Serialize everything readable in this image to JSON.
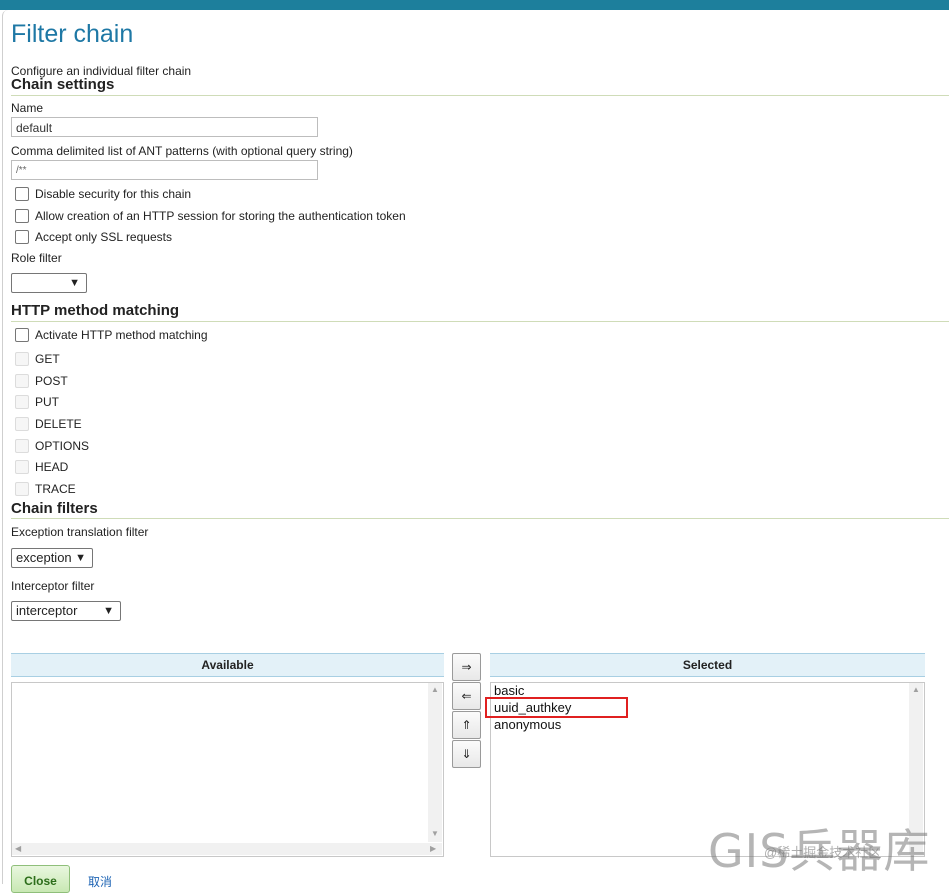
{
  "page": {
    "title": "Filter chain",
    "subtitle": "Configure an individual filter chain"
  },
  "chain_settings": {
    "heading": "Chain settings",
    "name_label": "Name",
    "name_value": "default",
    "patterns_label": "Comma delimited list of ANT patterns (with optional query string)",
    "patterns_value": "/**",
    "checkboxes": [
      {
        "label": "Disable security for this chain",
        "checked": false
      },
      {
        "label": "Allow creation of an HTTP session for storing the authentication token",
        "checked": false
      },
      {
        "label": "Accept only SSL requests",
        "checked": false
      }
    ],
    "role_filter_label": "Role filter",
    "role_filter_value": ""
  },
  "http_matching": {
    "heading": "HTTP method matching",
    "activate_label": "Activate HTTP method matching",
    "methods": [
      "GET",
      "POST",
      "PUT",
      "DELETE",
      "OPTIONS",
      "HEAD",
      "TRACE"
    ]
  },
  "chain_filters": {
    "heading": "Chain filters",
    "exception_label": "Exception translation filter",
    "exception_value": "exception",
    "interceptor_label": "Interceptor filter",
    "interceptor_value": "interceptor"
  },
  "lists": {
    "available_header": "Available",
    "selected_header": "Selected",
    "available_items": [],
    "selected_items": [
      "basic",
      "uuid_authkey",
      "anonymous"
    ],
    "highlight_color": "#e02020"
  },
  "buttons": {
    "add": "⇒",
    "remove": "⇐",
    "up": "⇑",
    "down": "⇓",
    "close": "Close",
    "cancel": "取消"
  },
  "watermark": {
    "main": "GIS兵器库",
    "sub": "@稀土掘金技术社区"
  },
  "colors": {
    "accent": "#1e78a5",
    "topbar": "#1d7f9c"
  }
}
